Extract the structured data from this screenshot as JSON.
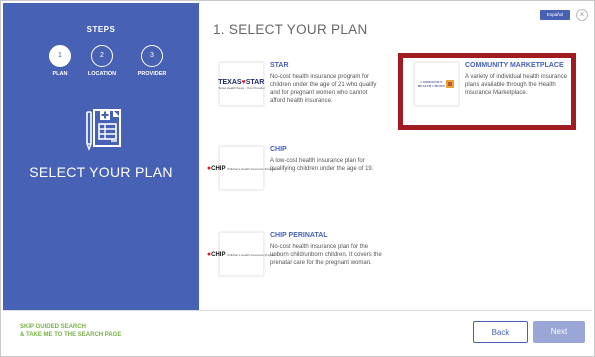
{
  "left_panel": {
    "steps_title": "STEPS",
    "steps": [
      {
        "number": "1",
        "label": "PLAN",
        "active": true
      },
      {
        "number": "2",
        "label": "LOCATION",
        "active": false
      },
      {
        "number": "3",
        "label": "PROVIDER",
        "active": false
      }
    ],
    "illustration_icon": "document-form-icon",
    "title": "SELECT YOUR PLAN"
  },
  "header": {
    "title": "1. SELECT YOUR PLAN",
    "language_button": "Español",
    "close_icon": "close-icon"
  },
  "plans": [
    {
      "id": "star",
      "name": "STAR",
      "description": "No-cost health insurance program for children under the age of 21 who qualify and for pregnant women who cannot afford health insurance.",
      "logo": {
        "text_left": "TEXAS",
        "text_right": "STAR",
        "subtitle": "Texas Health Steps · Your Provider"
      }
    },
    {
      "id": "community",
      "name": "COMMUNITY MARKETPLACE",
      "description": "A variety of individual health insurance plans available through the Health Insurance Marketplace.",
      "logo": {
        "line1": "COMMUNITY",
        "line2": "HEALTH CHOICE"
      },
      "selected": true
    },
    {
      "id": "chip",
      "name": "CHIP",
      "description": "A low-cost health insurance plan for qualifying children under the age of 19.",
      "logo": {
        "text": "CHIP",
        "small": "Children's Health Insurance Program"
      }
    },
    {
      "id": "chip-perinatal",
      "name": "CHIP PERINATAL",
      "description": "No-cost health insurance plan for the unborn child/unborn children. It covers the prenatal care for the pregnant woman.",
      "logo": {
        "text": "CHIP",
        "small": "Children's Health Insurance Program"
      }
    }
  ],
  "footer": {
    "skip_line1": "SKIP GUIDED SEARCH",
    "skip_line2": "& TAKE ME TO THE SEARCH PAGE",
    "back_label": "Back",
    "next_label": "Next"
  },
  "colors": {
    "panel_blue": "#4762b5",
    "selection_red": "#a01c22",
    "link_green": "#78b248",
    "next_disabled": "#99a6d6"
  }
}
